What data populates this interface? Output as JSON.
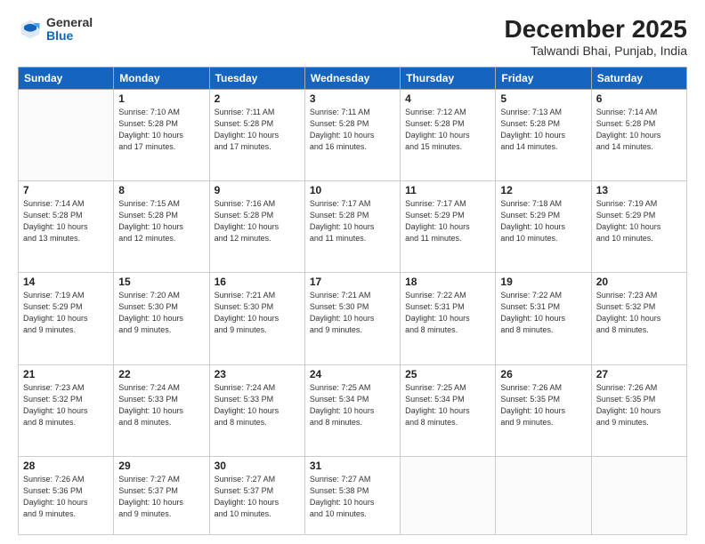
{
  "header": {
    "logo_general": "General",
    "logo_blue": "Blue",
    "title": "December 2025",
    "subtitle": "Talwandi Bhai, Punjab, India"
  },
  "days_of_week": [
    "Sunday",
    "Monday",
    "Tuesday",
    "Wednesday",
    "Thursday",
    "Friday",
    "Saturday"
  ],
  "weeks": [
    [
      {
        "day": "",
        "info": ""
      },
      {
        "day": "1",
        "info": "Sunrise: 7:10 AM\nSunset: 5:28 PM\nDaylight: 10 hours\nand 17 minutes."
      },
      {
        "day": "2",
        "info": "Sunrise: 7:11 AM\nSunset: 5:28 PM\nDaylight: 10 hours\nand 17 minutes."
      },
      {
        "day": "3",
        "info": "Sunrise: 7:11 AM\nSunset: 5:28 PM\nDaylight: 10 hours\nand 16 minutes."
      },
      {
        "day": "4",
        "info": "Sunrise: 7:12 AM\nSunset: 5:28 PM\nDaylight: 10 hours\nand 15 minutes."
      },
      {
        "day": "5",
        "info": "Sunrise: 7:13 AM\nSunset: 5:28 PM\nDaylight: 10 hours\nand 14 minutes."
      },
      {
        "day": "6",
        "info": "Sunrise: 7:14 AM\nSunset: 5:28 PM\nDaylight: 10 hours\nand 14 minutes."
      }
    ],
    [
      {
        "day": "7",
        "info": "Sunrise: 7:14 AM\nSunset: 5:28 PM\nDaylight: 10 hours\nand 13 minutes."
      },
      {
        "day": "8",
        "info": "Sunrise: 7:15 AM\nSunset: 5:28 PM\nDaylight: 10 hours\nand 12 minutes."
      },
      {
        "day": "9",
        "info": "Sunrise: 7:16 AM\nSunset: 5:28 PM\nDaylight: 10 hours\nand 12 minutes."
      },
      {
        "day": "10",
        "info": "Sunrise: 7:17 AM\nSunset: 5:28 PM\nDaylight: 10 hours\nand 11 minutes."
      },
      {
        "day": "11",
        "info": "Sunrise: 7:17 AM\nSunset: 5:29 PM\nDaylight: 10 hours\nand 11 minutes."
      },
      {
        "day": "12",
        "info": "Sunrise: 7:18 AM\nSunset: 5:29 PM\nDaylight: 10 hours\nand 10 minutes."
      },
      {
        "day": "13",
        "info": "Sunrise: 7:19 AM\nSunset: 5:29 PM\nDaylight: 10 hours\nand 10 minutes."
      }
    ],
    [
      {
        "day": "14",
        "info": "Sunrise: 7:19 AM\nSunset: 5:29 PM\nDaylight: 10 hours\nand 9 minutes."
      },
      {
        "day": "15",
        "info": "Sunrise: 7:20 AM\nSunset: 5:30 PM\nDaylight: 10 hours\nand 9 minutes."
      },
      {
        "day": "16",
        "info": "Sunrise: 7:21 AM\nSunset: 5:30 PM\nDaylight: 10 hours\nand 9 minutes."
      },
      {
        "day": "17",
        "info": "Sunrise: 7:21 AM\nSunset: 5:30 PM\nDaylight: 10 hours\nand 9 minutes."
      },
      {
        "day": "18",
        "info": "Sunrise: 7:22 AM\nSunset: 5:31 PM\nDaylight: 10 hours\nand 8 minutes."
      },
      {
        "day": "19",
        "info": "Sunrise: 7:22 AM\nSunset: 5:31 PM\nDaylight: 10 hours\nand 8 minutes."
      },
      {
        "day": "20",
        "info": "Sunrise: 7:23 AM\nSunset: 5:32 PM\nDaylight: 10 hours\nand 8 minutes."
      }
    ],
    [
      {
        "day": "21",
        "info": "Sunrise: 7:23 AM\nSunset: 5:32 PM\nDaylight: 10 hours\nand 8 minutes."
      },
      {
        "day": "22",
        "info": "Sunrise: 7:24 AM\nSunset: 5:33 PM\nDaylight: 10 hours\nand 8 minutes."
      },
      {
        "day": "23",
        "info": "Sunrise: 7:24 AM\nSunset: 5:33 PM\nDaylight: 10 hours\nand 8 minutes."
      },
      {
        "day": "24",
        "info": "Sunrise: 7:25 AM\nSunset: 5:34 PM\nDaylight: 10 hours\nand 8 minutes."
      },
      {
        "day": "25",
        "info": "Sunrise: 7:25 AM\nSunset: 5:34 PM\nDaylight: 10 hours\nand 8 minutes."
      },
      {
        "day": "26",
        "info": "Sunrise: 7:26 AM\nSunset: 5:35 PM\nDaylight: 10 hours\nand 9 minutes."
      },
      {
        "day": "27",
        "info": "Sunrise: 7:26 AM\nSunset: 5:35 PM\nDaylight: 10 hours\nand 9 minutes."
      }
    ],
    [
      {
        "day": "28",
        "info": "Sunrise: 7:26 AM\nSunset: 5:36 PM\nDaylight: 10 hours\nand 9 minutes."
      },
      {
        "day": "29",
        "info": "Sunrise: 7:27 AM\nSunset: 5:37 PM\nDaylight: 10 hours\nand 9 minutes."
      },
      {
        "day": "30",
        "info": "Sunrise: 7:27 AM\nSunset: 5:37 PM\nDaylight: 10 hours\nand 10 minutes."
      },
      {
        "day": "31",
        "info": "Sunrise: 7:27 AM\nSunset: 5:38 PM\nDaylight: 10 hours\nand 10 minutes."
      },
      {
        "day": "",
        "info": ""
      },
      {
        "day": "",
        "info": ""
      },
      {
        "day": "",
        "info": ""
      }
    ]
  ]
}
